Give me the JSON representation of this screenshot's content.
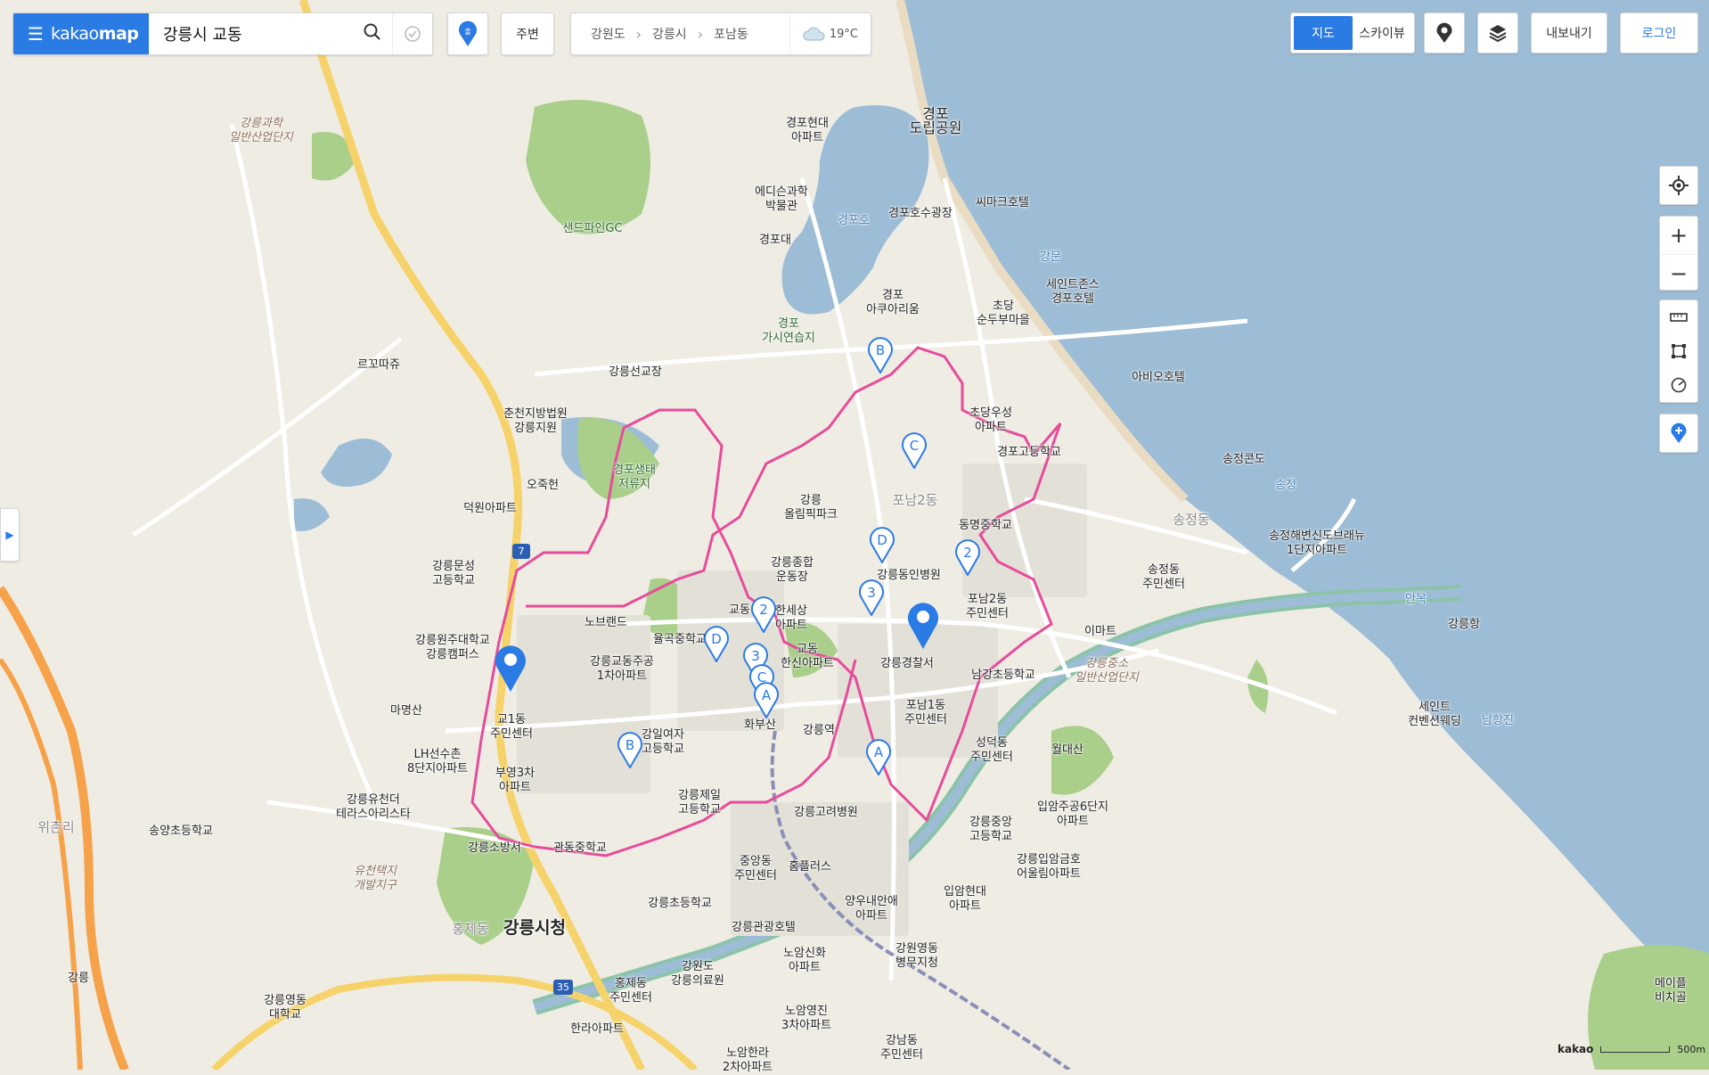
{
  "app": {
    "logo_light": "kakao",
    "logo_bold": "map"
  },
  "search": {
    "query": "강릉시 교동"
  },
  "nearby_label": "주변",
  "breadcrumb": [
    "강원도",
    "강릉시",
    "포남동"
  ],
  "weather": {
    "temp": "19°C"
  },
  "map_type": {
    "map": "지도",
    "sky": "스카이뷰"
  },
  "export_label": "내보내기",
  "login_label": "로그인",
  "scale": {
    "logo": "kakao",
    "distance": "500m"
  },
  "colors": {
    "accent": "#2b7be4",
    "boundary": "#e64c9b",
    "sea": "#9dbdd6",
    "land": "#efece4",
    "forest": "#a9cf8a",
    "river": "#88bfa6"
  },
  "map_labels": [
    {
      "t": "강릉과학\n일반산업단지",
      "c": "ind"
    },
    {
      "t": "경포현대\n아파트",
      "c": ""
    },
    {
      "t": "경포\n도립공원",
      "c": "big-ish"
    },
    {
      "t": "에디슨과학\n박물관",
      "c": ""
    },
    {
      "t": "경포대",
      "c": ""
    },
    {
      "t": "경포호",
      "c": "water"
    },
    {
      "t": "경포호수광장",
      "c": ""
    },
    {
      "t": "씨마크호텔",
      "c": ""
    },
    {
      "t": "샌드파인GC",
      "c": "green"
    },
    {
      "t": "강문",
      "c": "water"
    },
    {
      "t": "세인트존스\n경포호텔",
      "c": ""
    },
    {
      "t": "경포\n아쿠아리움",
      "c": ""
    },
    {
      "t": "초당\n순두부마을",
      "c": ""
    },
    {
      "t": "경포\n가시연습지",
      "c": "green"
    },
    {
      "t": "르꼬따쥬",
      "c": ""
    },
    {
      "t": "강릉선교장",
      "c": ""
    },
    {
      "t": "아비오호텔",
      "c": ""
    },
    {
      "t": "춘천지방법원\n강릉지원",
      "c": ""
    },
    {
      "t": "초당우성\n아파트",
      "c": ""
    },
    {
      "t": "경포고등학교",
      "c": ""
    },
    {
      "t": "송정콘도",
      "c": ""
    },
    {
      "t": "송정",
      "c": "water"
    },
    {
      "t": "오죽헌",
      "c": ""
    },
    {
      "t": "경포생태\n저류지",
      "c": "green"
    },
    {
      "t": "강릉\n올림픽파크",
      "c": ""
    },
    {
      "t": "포남2동",
      "c": "district"
    },
    {
      "t": "송정동",
      "c": "district"
    },
    {
      "t": "덕원아파트",
      "c": ""
    },
    {
      "t": "동명중학교",
      "c": ""
    },
    {
      "t": "송정해변신도브래뉴\n1단지아파트",
      "c": ""
    },
    {
      "t": "강릉문성\n고등학교",
      "c": ""
    },
    {
      "t": "강릉종합\n운동장",
      "c": ""
    },
    {
      "t": "강릉동인병원",
      "c": ""
    },
    {
      "t": "송정동\n주민센터",
      "c": ""
    },
    {
      "t": "안목",
      "c": "water"
    },
    {
      "t": "강릉항",
      "c": ""
    },
    {
      "t": "노브랜드",
      "c": ""
    },
    {
      "t": "교동",
      "c": ""
    },
    {
      "t": "한세상\n아파트",
      "c": ""
    },
    {
      "t": "포남2동\n주민센터",
      "c": ""
    },
    {
      "t": "이마트",
      "c": ""
    },
    {
      "t": "강릉원주대학교\n강릉캠퍼스",
      "c": ""
    },
    {
      "t": "율곡중학교",
      "c": ""
    },
    {
      "t": "교동\n한신아파트",
      "c": ""
    },
    {
      "t": "강릉경찰서",
      "c": ""
    },
    {
      "t": "남강초등학교",
      "c": ""
    },
    {
      "t": "강릉중소\n일반산업단지",
      "c": "ind"
    },
    {
      "t": "강릉교동주공\n1차아파트",
      "c": ""
    },
    {
      "t": "세인트\n컨벤션웨딩",
      "c": ""
    },
    {
      "t": "남항진",
      "c": "water"
    },
    {
      "t": "마명산",
      "c": ""
    },
    {
      "t": "교1동\n주민센터",
      "c": ""
    },
    {
      "t": "포남1동\n주민센터",
      "c": ""
    },
    {
      "t": "강릉역",
      "c": ""
    },
    {
      "t": "화부산",
      "c": ""
    },
    {
      "t": "강일여자\n고등학교",
      "c": ""
    },
    {
      "t": "월대산",
      "c": ""
    },
    {
      "t": "성덕동\n주민센터",
      "c": ""
    },
    {
      "t": "LH선수촌\n8단지아파트",
      "c": ""
    },
    {
      "t": "부영3차\n아파트",
      "c": ""
    },
    {
      "t": "강릉유천더\n테라스아리스타",
      "c": ""
    },
    {
      "t": "강릉제일\n고등학교",
      "c": ""
    },
    {
      "t": "강릉고려병원",
      "c": ""
    },
    {
      "t": "입암주공6단지\n아파트",
      "c": ""
    },
    {
      "t": "위촌리",
      "c": "district"
    },
    {
      "t": "송양초등학교",
      "c": ""
    },
    {
      "t": "강릉중앙\n고등학교",
      "c": ""
    },
    {
      "t": "강릉소방서",
      "c": ""
    },
    {
      "t": "관동중학교",
      "c": ""
    },
    {
      "t": "중앙동\n주민센터",
      "c": ""
    },
    {
      "t": "홈플러스",
      "c": ""
    },
    {
      "t": "강릉입암금호\n어울림아파트",
      "c": ""
    },
    {
      "t": "유천택지\n개발지구",
      "c": "ind"
    },
    {
      "t": "강릉초등학교",
      "c": ""
    },
    {
      "t": "양우내안애\n아파트",
      "c": ""
    },
    {
      "t": "입암현대\n아파트",
      "c": ""
    },
    {
      "t": "홍제동",
      "c": "district"
    },
    {
      "t": "강릉시청",
      "c": "big"
    },
    {
      "t": "강릉관광호텔",
      "c": ""
    },
    {
      "t": "강원영동\n병무지청",
      "c": ""
    },
    {
      "t": "노암신화\n아파트",
      "c": ""
    },
    {
      "t": "강원도\n강릉의료원",
      "c": ""
    },
    {
      "t": "강릉",
      "c": ""
    },
    {
      "t": "홍제동\n주민센터",
      "c": ""
    },
    {
      "t": "강릉영동\n대학교",
      "c": ""
    },
    {
      "t": "노암영진\n3차아파트",
      "c": ""
    },
    {
      "t": "메이플비치골",
      "c": ""
    },
    {
      "t": "한라아파트",
      "c": ""
    },
    {
      "t": "강남동\n주민센터",
      "c": ""
    },
    {
      "t": "노암한라\n2차아파트",
      "c": ""
    }
  ],
  "pins": [
    "B",
    "C",
    "D",
    "2",
    "3",
    "D",
    "2",
    "3",
    "C",
    "A",
    "B",
    "A"
  ],
  "route_numbers": [
    "7",
    "35"
  ]
}
